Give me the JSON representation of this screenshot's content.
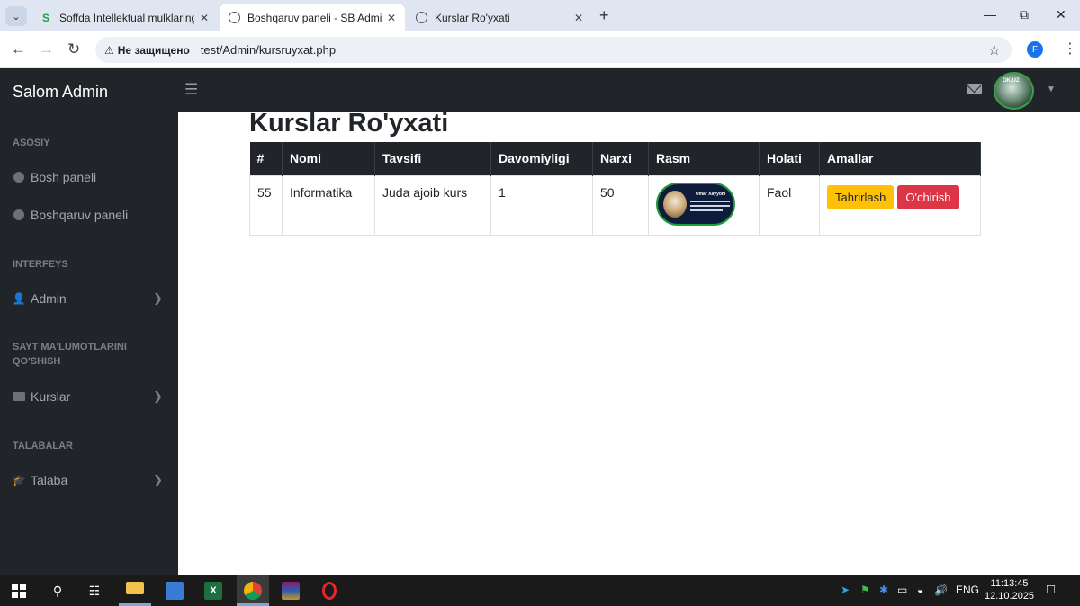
{
  "browser": {
    "tabs": [
      {
        "title": "Soffda Intellektual mulklaringiz",
        "favicon": "soffda-logo-icon",
        "active": false
      },
      {
        "title": "Boshqaruv paneli - SB Admin",
        "favicon": "globe-icon",
        "active": true
      },
      {
        "title": "Kurslar Ro'yxati",
        "favicon": "globe-icon",
        "active": false
      }
    ],
    "security_text": "Не защищено",
    "url": "test/Admin/kursruyxat.php",
    "profile_initial": "F"
  },
  "topbar": {
    "brand": "Salom Admin",
    "avatar_text": "OK.UZ"
  },
  "sidebar": {
    "sections": [
      {
        "heading": "ASOSIY"
      },
      {
        "heading": "INTERFEYS"
      },
      {
        "heading": "SAYT MA'LUMOTLARINI QO'SHISH"
      },
      {
        "heading": "TALABALAR"
      }
    ],
    "items": [
      {
        "label": "Bosh paneli",
        "icon": "gauge-icon"
      },
      {
        "label": "Boshqaruv paneli",
        "icon": "gauge-icon"
      },
      {
        "label": "Admin",
        "icon": "user-icon"
      },
      {
        "label": "Kurslar",
        "icon": "folder-icon"
      },
      {
        "label": "Talaba",
        "icon": "student-icon"
      }
    ]
  },
  "main": {
    "title": "Kurslar Ro'yxati",
    "table": {
      "headers": [
        "#",
        "Nomi",
        "Tavsifi",
        "Davomiyligi",
        "Narxi",
        "Rasm",
        "Holati",
        "Amallar"
      ],
      "rows": [
        {
          "id": "55",
          "nomi": "Informatika",
          "tavsifi": "Juda ajoib kurs",
          "davomiyligi": "1",
          "narxi": "50",
          "rasm_title": "Umar Xayyom",
          "holati": "Faol",
          "edit_label": "Tahrirlash",
          "delete_label": "O'chirish"
        }
      ]
    }
  },
  "taskbar": {
    "language": "ENG",
    "time": "11:13:45",
    "date": "12.10.2025"
  },
  "colors": {
    "dark": "#212529",
    "warning": "#ffc107",
    "danger": "#dc3545"
  }
}
